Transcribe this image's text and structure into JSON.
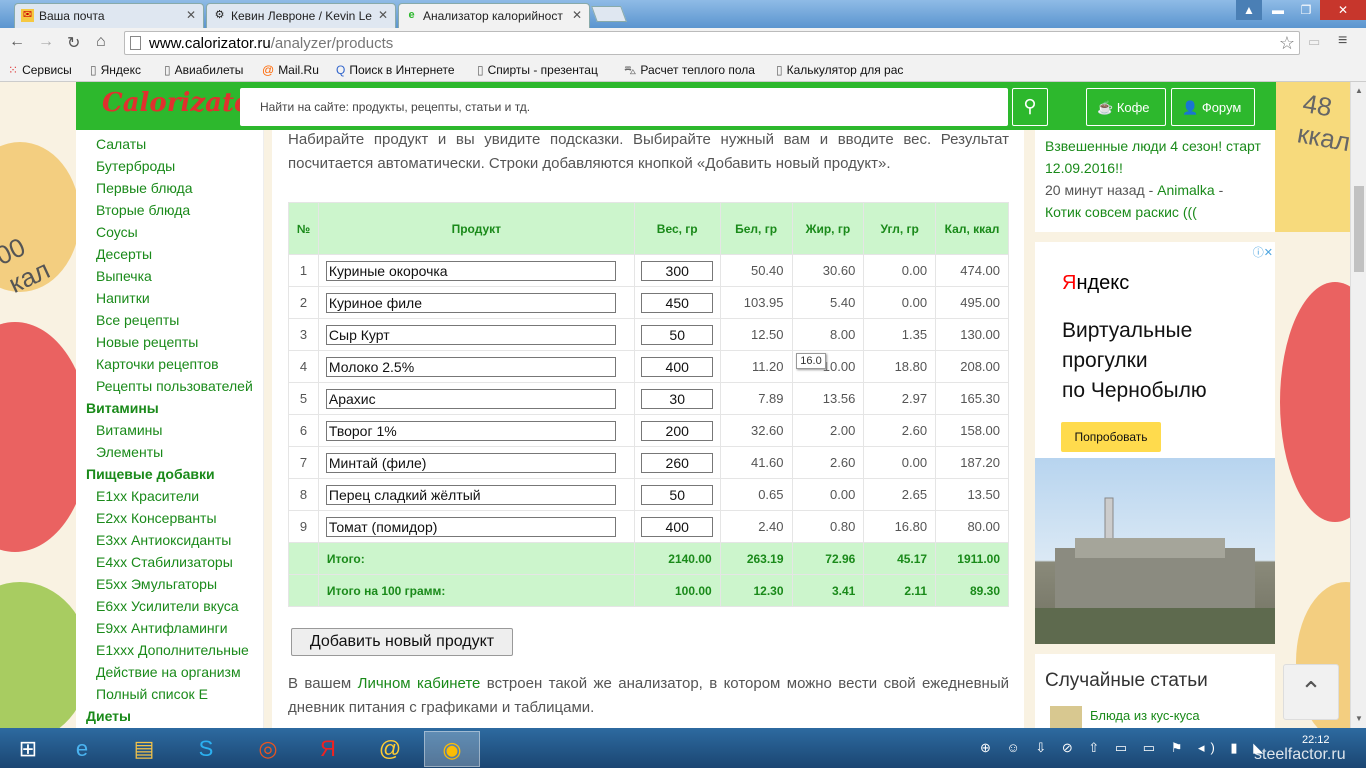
{
  "browser": {
    "tabs": [
      {
        "icon": "mail-icon",
        "title": "Ваша почта"
      },
      {
        "icon": "forum-icon",
        "title": "Кевин Левроне / Kevin Le"
      },
      {
        "icon": "calorizator-icon",
        "title": "Анализатор калорийност"
      }
    ],
    "window_min": "▬",
    "window_max": "❐",
    "window_close": "✕",
    "url_host": "www.calorizator.ru",
    "url_path": "/analyzer/products",
    "bookmarks": [
      {
        "icon": "apps-icon",
        "label": "Сервисы"
      },
      {
        "icon": "page-icon",
        "label": "Яндекс"
      },
      {
        "icon": "page-icon",
        "label": "Авиабилеты"
      },
      {
        "icon": "mailru-icon",
        "label": "Mail.Ru"
      },
      {
        "icon": "search-icon",
        "label": "Поиск в Интернете"
      },
      {
        "icon": "page-icon",
        "label": "Спирты - презентац"
      },
      {
        "icon": "car-icon",
        "label": "Расчет теплого пола"
      },
      {
        "icon": "page-icon",
        "label": "Калькулятор для рас"
      }
    ]
  },
  "header": {
    "logo_c": "C",
    "logo_rest": "alorizator",
    "search_placeholder": "Найти на сайте: продукты, рецепты, статьи и тд.",
    "coffee_label": "Кофе",
    "forum_label": "Форум"
  },
  "sidebar": {
    "items": [
      {
        "type": "link",
        "label": "Салаты"
      },
      {
        "type": "link",
        "label": "Бутерброды"
      },
      {
        "type": "link",
        "label": "Первые блюда"
      },
      {
        "type": "link",
        "label": "Вторые блюда"
      },
      {
        "type": "link",
        "label": "Соусы"
      },
      {
        "type": "link",
        "label": "Десерты"
      },
      {
        "type": "link",
        "label": "Выпечка"
      },
      {
        "type": "link",
        "label": "Напитки"
      },
      {
        "type": "link",
        "label": "Все рецепты"
      },
      {
        "type": "link",
        "label": "Новые рецепты"
      },
      {
        "type": "link",
        "label": "Карточки рецептов"
      },
      {
        "type": "link",
        "label": "Рецепты пользователей"
      },
      {
        "type": "head",
        "label": "Витамины"
      },
      {
        "type": "link",
        "label": "Витамины"
      },
      {
        "type": "link",
        "label": "Элементы"
      },
      {
        "type": "head",
        "label": "Пищевые добавки"
      },
      {
        "type": "link",
        "label": "E1xx Красители"
      },
      {
        "type": "link",
        "label": "E2xx Консерванты"
      },
      {
        "type": "link",
        "label": "E3xx Антиоксиданты"
      },
      {
        "type": "link",
        "label": "E4xx Стабилизаторы"
      },
      {
        "type": "link",
        "label": "E5xx Эмульгаторы"
      },
      {
        "type": "link",
        "label": "E6xx Усилители вкуса"
      },
      {
        "type": "link",
        "label": "E9xx Антифламинги"
      },
      {
        "type": "link",
        "label": "E1xxx Дополнительные"
      },
      {
        "type": "link",
        "label": "Действие на организм"
      },
      {
        "type": "link",
        "label": "Полный список Е"
      },
      {
        "type": "head",
        "label": "Диеты"
      }
    ]
  },
  "main": {
    "intro": "Набирайте продукт и вы увидите подсказки. Выбирайте нужный вам и вводите вес. Результат посчитается автоматически. Строки добавляются кнопкой «Добавить новый продукт».",
    "columns": [
      "№",
      "Продукт",
      "Вес, гр",
      "Бел, гр",
      "Жир, гр",
      "Угл, гр",
      "Кал, ккал"
    ],
    "rows": [
      {
        "n": "1",
        "product": "Куриные окорочка",
        "weight": "300",
        "protein": "50.40",
        "fat": "30.60",
        "carbs": "0.00",
        "kcal": "474.00"
      },
      {
        "n": "2",
        "product": "Куриное филе",
        "weight": "450",
        "protein": "103.95",
        "fat": "5.40",
        "carbs": "0.00",
        "kcal": "495.00"
      },
      {
        "n": "3",
        "product": "Сыр Курт",
        "weight": "50",
        "protein": "12.50",
        "fat": "8.00",
        "carbs": "1.35",
        "kcal": "130.00"
      },
      {
        "n": "4",
        "product": "Молоко 2.5%",
        "weight": "400",
        "protein": "11.20",
        "fat": "10.00",
        "carbs": "18.80",
        "kcal": "208.00"
      },
      {
        "n": "5",
        "product": "Арахис",
        "weight": "30",
        "protein": "7.89",
        "fat": "13.56",
        "carbs": "2.97",
        "kcal": "165.30"
      },
      {
        "n": "6",
        "product": "Творог 1%",
        "weight": "200",
        "protein": "32.60",
        "fat": "2.00",
        "carbs": "2.60",
        "kcal": "158.00"
      },
      {
        "n": "7",
        "product": "Минтай (филе)",
        "weight": "260",
        "protein": "41.60",
        "fat": "2.60",
        "carbs": "0.00",
        "kcal": "187.20"
      },
      {
        "n": "8",
        "product": "Перец сладкий жёлтый",
        "weight": "50",
        "protein": "0.65",
        "fat": "0.00",
        "carbs": "2.65",
        "kcal": "13.50"
      },
      {
        "n": "9",
        "product": "Томат (помидор)",
        "weight": "400",
        "protein": "2.40",
        "fat": "0.80",
        "carbs": "16.80",
        "kcal": "80.00"
      }
    ],
    "total": {
      "label": "Итого:",
      "weight": "2140.00",
      "protein": "263.19",
      "fat": "72.96",
      "carbs": "45.17",
      "kcal": "1911.00"
    },
    "per100": {
      "label": "Итого на 100 грамм:",
      "weight": "100.00",
      "protein": "12.30",
      "fat": "3.41",
      "carbs": "2.11",
      "kcal": "89.30"
    },
    "tooltip": "16.0",
    "add_button": "Добавить новый продукт",
    "outro_before": "В вашем ",
    "outro_link": "Личном кабинете",
    "outro_after": " встроен такой же анализатор, в котором можно вести свой ежедневный дневник питания с графиками и таблицами."
  },
  "right": {
    "news_link": "Взвешенные люди 4 сезон! старт 12.09.2016!!",
    "news_time": "20 минут назад - ",
    "news_author": "Animalka",
    "news_dash": " - ",
    "news_topic": "Котик совсем раскис (((",
    "ad_logo_first": "Я",
    "ad_logo_rest": "ндекс",
    "ad_line1": "Виртуальные",
    "ad_line2": "прогулки",
    "ad_line3": "по Чернобылю",
    "ad_button": "Попробовать",
    "random_title": "Случайные статьи",
    "random_item": "Блюда из кус-куса"
  },
  "decor": {
    "kcal_top": "48",
    "kcal_unit": "ккал",
    "left_num": "00",
    "left_unit": "кал"
  },
  "taskbar": {
    "apps": [
      "windows-start-icon",
      "ie-icon",
      "explorer-icon",
      "skype-icon",
      "ubuntu-icon",
      "yandex-icon",
      "mail-agent-icon",
      "chrome-icon"
    ],
    "tray": "⊕ ☺ ⇩ ⊘ ⇧ ▭ ▭ ⚑ ◂) ▮ ◣",
    "time": "22:12",
    "watermark": "steelfactor.ru"
  }
}
